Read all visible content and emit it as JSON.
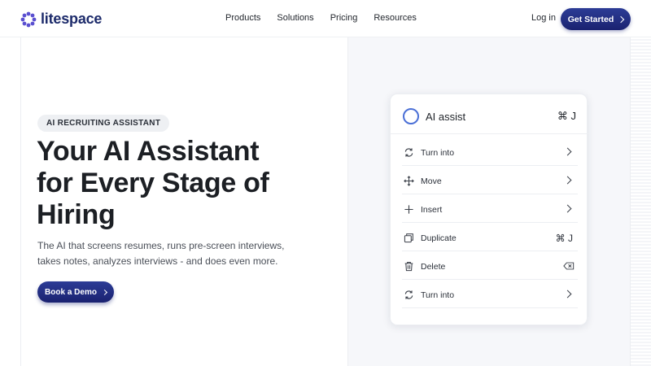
{
  "nav": {
    "brand": "litespace",
    "links": [
      "Products",
      "Solutions",
      "Pricing",
      "Resources"
    ],
    "login": "Log in",
    "cta": "Get Started"
  },
  "hero": {
    "badge": "AI RECRUITING ASSISTANT",
    "headline_lines": [
      "Your AI Assistant",
      "for Every Stage of",
      "Hiring"
    ],
    "subtitle_lines": [
      "The AI that screens resumes, runs pre-screen interviews,",
      "takes notes, analyzes interviews - and does even more."
    ],
    "button": "Book a Demo"
  },
  "card": {
    "title": "AI assist",
    "shortcut": "⌘ J",
    "items": [
      {
        "label": "Turn into",
        "icon": "refresh-icon",
        "trail": "chevron"
      },
      {
        "label": "Move",
        "icon": "move-icon",
        "trail": "chevron"
      },
      {
        "label": "Insert",
        "icon": "plus-icon",
        "trail": "chevron"
      },
      {
        "label": "Duplicate",
        "icon": "duplicate-icon",
        "trail": "⌘ J"
      },
      {
        "label": "Delete",
        "icon": "trash-icon",
        "trail": "backspace"
      },
      {
        "label": "Turn into",
        "icon": "refresh-icon",
        "trail": "chevron"
      }
    ]
  },
  "colors": {
    "brand": "#1d2b6b",
    "button": "#22307f",
    "accent_ring": "#4a6fd6"
  }
}
